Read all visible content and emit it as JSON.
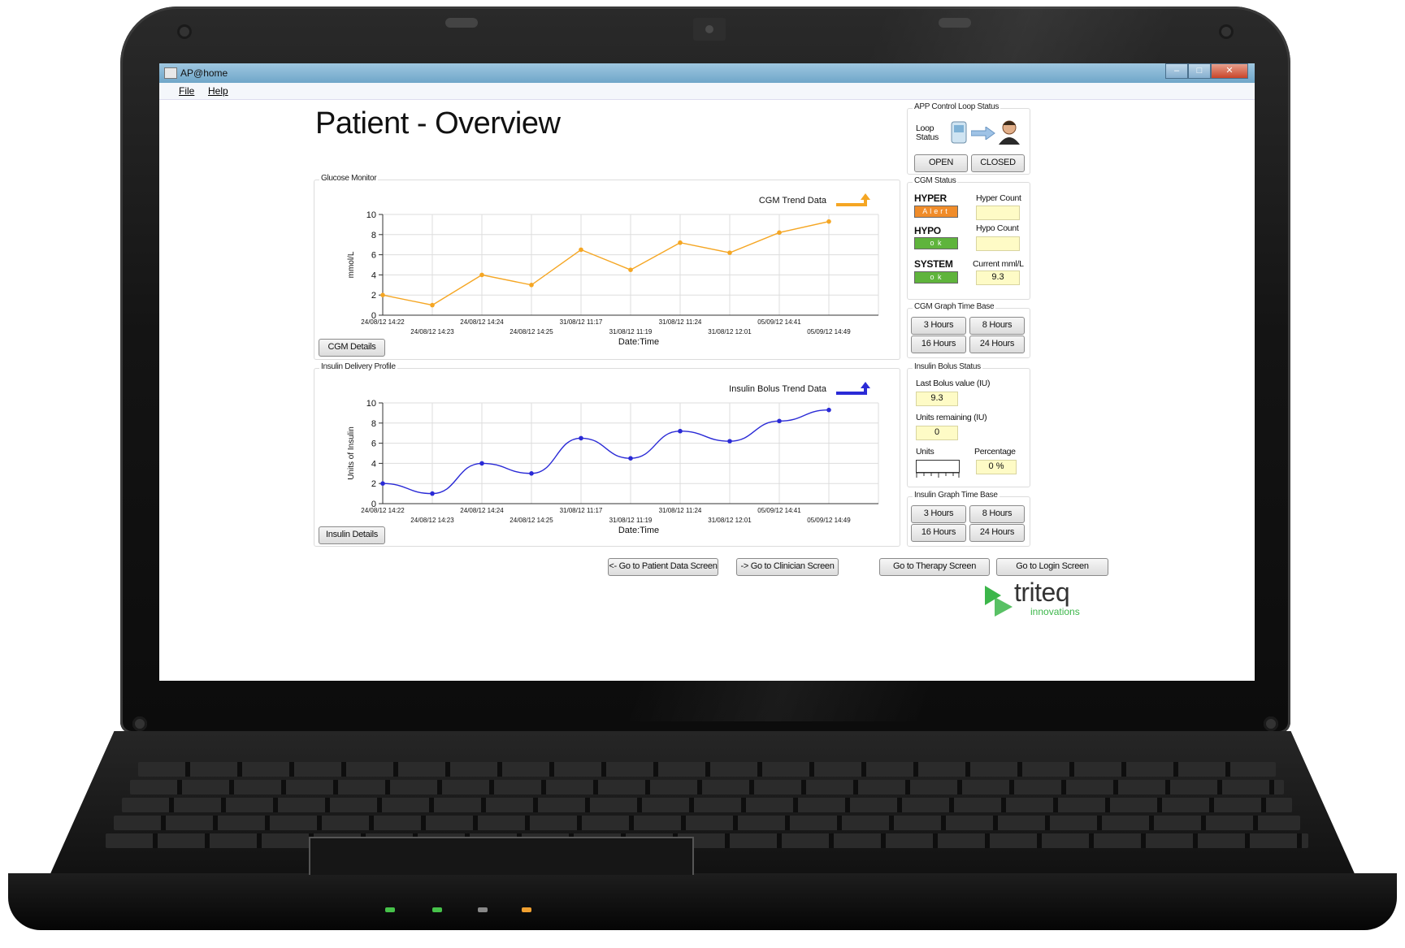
{
  "window": {
    "title": "AP@home",
    "menu": [
      "File",
      "Help"
    ]
  },
  "page": {
    "title": "Patient - Overview"
  },
  "loop_status": {
    "group_label": "APP Control Loop Status",
    "label_line1": "Loop",
    "label_line2": "Status",
    "open_label": "OPEN",
    "closed_label": "CLOSED"
  },
  "cgm_status": {
    "group_label": "CGM Status",
    "hyper_label": "HYPER",
    "hyper_state": "Alert",
    "hyper_count_label": "Hyper Count",
    "hyper_count": "",
    "hypo_label": "HYPO",
    "hypo_state": "o k",
    "hypo_count_label": "Hypo Count",
    "hypo_count": "",
    "system_label": "SYSTEM",
    "system_state": "o k",
    "current_label": "Current mml/L",
    "current_value": "9.3",
    "colors": {
      "alert": "#f08c2a",
      "ok": "#5fb43c"
    }
  },
  "cgm_time_base": {
    "group_label": "CGM Graph Time Base",
    "buttons": [
      "3 Hours",
      "8 Hours",
      "16 Hours",
      "24 Hours"
    ]
  },
  "insulin_bolus": {
    "group_label": "Insulin Bolus Status",
    "last_label": "Last Bolus value (IU)",
    "last_value": "9.3",
    "remaining_label": "Units remaining (IU)",
    "remaining_value": "0",
    "units_label": "Units",
    "percentage_label": "Percentage",
    "percentage_value": "0 %",
    "units_level": 0
  },
  "insulin_time_base": {
    "group_label": "Insulin Graph Time Base",
    "buttons": [
      "3 Hours",
      "8 Hours",
      "16 Hours",
      "24 Hours"
    ]
  },
  "glucose_panel": {
    "group_label": "Glucose Monitor",
    "details_button": "CGM Details"
  },
  "insulin_panel": {
    "group_label": "Insulin Delivery Profile",
    "details_button": "Insulin Details"
  },
  "nav": {
    "patient_data": "<- Go to Patient Data Screen",
    "clinician": "-> Go to Clinician Screen",
    "therapy": "Go to Therapy Screen",
    "login": "Go to Login Screen"
  },
  "logo": {
    "name": "triteq",
    "sub": "innovations",
    "color": "#3cb64a"
  },
  "chart_data": [
    {
      "type": "line",
      "legend": "CGM Trend Data",
      "ylabel": "mmol/L",
      "xlabel": "Date:Time",
      "ylim": [
        0,
        10
      ],
      "yticks": [
        0,
        2,
        4,
        6,
        8,
        10
      ],
      "categories": [
        "24/08/12 14:22",
        "24/08/12 14:23",
        "24/08/12 14:24",
        "24/08/12 14:25",
        "31/08/12 11:17",
        "31/08/12 11:19",
        "31/08/12 11:24",
        "31/08/12 12:01",
        "05/09/12 14:41",
        "05/09/12 14:49"
      ],
      "values": [
        2,
        1,
        4,
        3,
        6.5,
        4.5,
        7.2,
        6.2,
        8.2,
        9.3
      ],
      "color": "#f5a623",
      "smooth": false,
      "legend_position": "top-right",
      "grid": true
    },
    {
      "type": "line",
      "legend": "Insulin Bolus Trend Data",
      "ylabel": "Units of Insulin",
      "xlabel": "Date:Time",
      "ylim": [
        0,
        10
      ],
      "yticks": [
        0,
        2,
        4,
        6,
        8,
        10
      ],
      "categories": [
        "24/08/12 14:22",
        "24/08/12 14:23",
        "24/08/12 14:24",
        "24/08/12 14:25",
        "31/08/12 11:17",
        "31/08/12 11:19",
        "31/08/12 11:24",
        "31/08/12 12:01",
        "05/09/12 14:41",
        "05/09/12 14:49"
      ],
      "values": [
        2,
        1,
        4,
        3,
        6.5,
        4.5,
        7.2,
        6.2,
        8.2,
        9.3
      ],
      "color": "#2a2ad6",
      "smooth": true,
      "legend_position": "top-right",
      "grid": true
    }
  ]
}
